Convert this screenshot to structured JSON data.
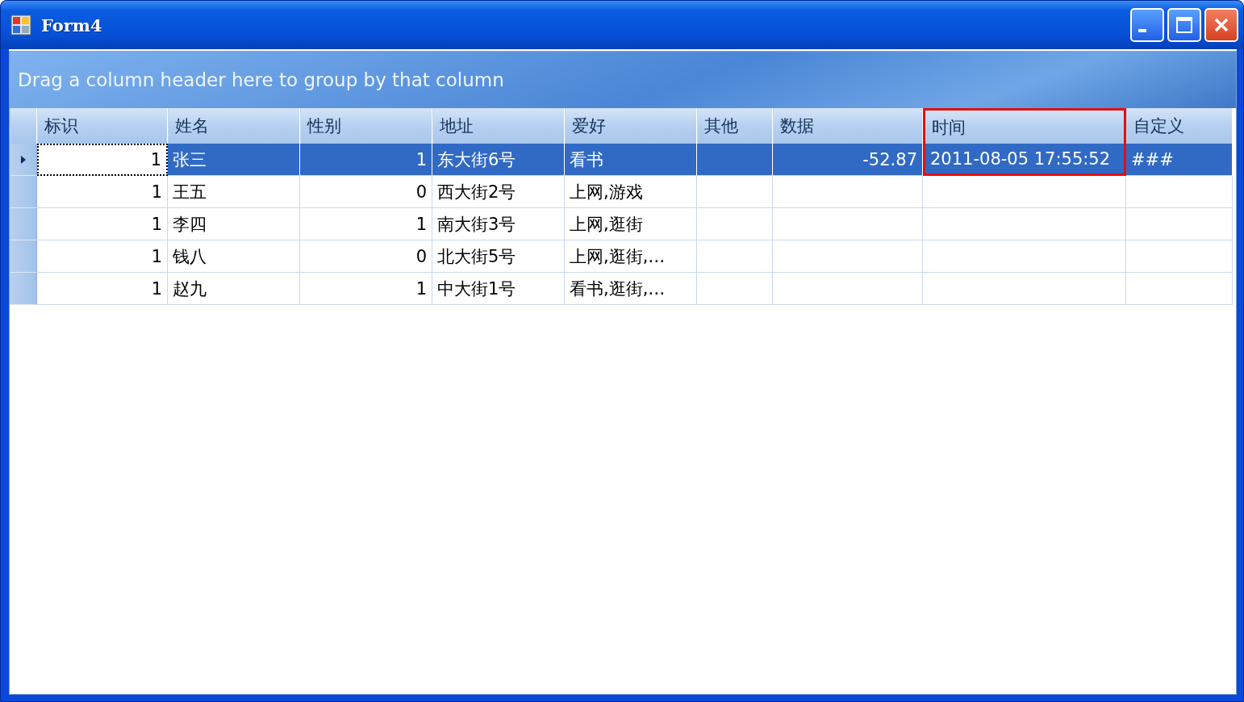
{
  "window": {
    "title": "Form4"
  },
  "group_panel": {
    "text": "Drag a column header here to group by that column"
  },
  "table": {
    "columns": [
      {
        "label": "标识",
        "kind": "number",
        "highlighted": false
      },
      {
        "label": "姓名",
        "kind": "text",
        "highlighted": false
      },
      {
        "label": "性别",
        "kind": "number",
        "highlighted": false
      },
      {
        "label": "地址",
        "kind": "text",
        "highlighted": false
      },
      {
        "label": "爱好",
        "kind": "text",
        "highlighted": false
      },
      {
        "label": "其他",
        "kind": "text",
        "highlighted": false
      },
      {
        "label": "数据",
        "kind": "number",
        "highlighted": false
      },
      {
        "label": "时间",
        "kind": "text",
        "highlighted": true
      },
      {
        "label": "自定义",
        "kind": "text",
        "highlighted": false
      }
    ],
    "rows": [
      {
        "selected": true,
        "current": true,
        "cells": [
          "1",
          "张三",
          "1",
          "东大街6号",
          "看书",
          "",
          "-52.87",
          "2011-08-05 17:55:52",
          "###"
        ]
      },
      {
        "selected": false,
        "current": false,
        "cells": [
          "1",
          "王五",
          "0",
          "西大街2号",
          "上网,游戏",
          "",
          "",
          "",
          ""
        ]
      },
      {
        "selected": false,
        "current": false,
        "cells": [
          "1",
          "李四",
          "1",
          "南大街3号",
          "上网,逛街",
          "",
          "",
          "",
          ""
        ]
      },
      {
        "selected": false,
        "current": false,
        "cells": [
          "1",
          "钱八",
          "0",
          "北大街5号",
          "上网,逛街,…",
          "",
          "",
          "",
          ""
        ]
      },
      {
        "selected": false,
        "current": false,
        "cells": [
          "1",
          "赵九",
          "1",
          "中大街1号",
          "看书,逛街,…",
          "",
          "",
          "",
          ""
        ]
      }
    ]
  }
}
